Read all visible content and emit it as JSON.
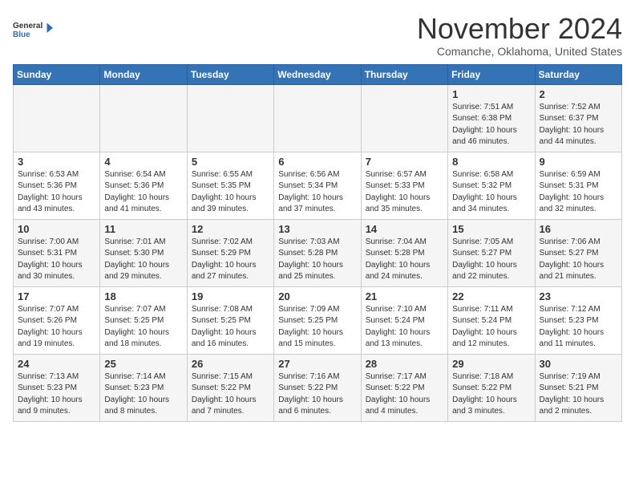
{
  "logo": {
    "general": "General",
    "blue": "Blue"
  },
  "title": "November 2024",
  "location": "Comanche, Oklahoma, United States",
  "weekdays": [
    "Sunday",
    "Monday",
    "Tuesday",
    "Wednesday",
    "Thursday",
    "Friday",
    "Saturday"
  ],
  "weeks": [
    [
      {
        "day": "",
        "info": ""
      },
      {
        "day": "",
        "info": ""
      },
      {
        "day": "",
        "info": ""
      },
      {
        "day": "",
        "info": ""
      },
      {
        "day": "",
        "info": ""
      },
      {
        "day": "1",
        "info": "Sunrise: 7:51 AM\nSunset: 6:38 PM\nDaylight: 10 hours\nand 46 minutes."
      },
      {
        "day": "2",
        "info": "Sunrise: 7:52 AM\nSunset: 6:37 PM\nDaylight: 10 hours\nand 44 minutes."
      }
    ],
    [
      {
        "day": "3",
        "info": "Sunrise: 6:53 AM\nSunset: 5:36 PM\nDaylight: 10 hours\nand 43 minutes."
      },
      {
        "day": "4",
        "info": "Sunrise: 6:54 AM\nSunset: 5:36 PM\nDaylight: 10 hours\nand 41 minutes."
      },
      {
        "day": "5",
        "info": "Sunrise: 6:55 AM\nSunset: 5:35 PM\nDaylight: 10 hours\nand 39 minutes."
      },
      {
        "day": "6",
        "info": "Sunrise: 6:56 AM\nSunset: 5:34 PM\nDaylight: 10 hours\nand 37 minutes."
      },
      {
        "day": "7",
        "info": "Sunrise: 6:57 AM\nSunset: 5:33 PM\nDaylight: 10 hours\nand 35 minutes."
      },
      {
        "day": "8",
        "info": "Sunrise: 6:58 AM\nSunset: 5:32 PM\nDaylight: 10 hours\nand 34 minutes."
      },
      {
        "day": "9",
        "info": "Sunrise: 6:59 AM\nSunset: 5:31 PM\nDaylight: 10 hours\nand 32 minutes."
      }
    ],
    [
      {
        "day": "10",
        "info": "Sunrise: 7:00 AM\nSunset: 5:31 PM\nDaylight: 10 hours\nand 30 minutes."
      },
      {
        "day": "11",
        "info": "Sunrise: 7:01 AM\nSunset: 5:30 PM\nDaylight: 10 hours\nand 29 minutes."
      },
      {
        "day": "12",
        "info": "Sunrise: 7:02 AM\nSunset: 5:29 PM\nDaylight: 10 hours\nand 27 minutes."
      },
      {
        "day": "13",
        "info": "Sunrise: 7:03 AM\nSunset: 5:28 PM\nDaylight: 10 hours\nand 25 minutes."
      },
      {
        "day": "14",
        "info": "Sunrise: 7:04 AM\nSunset: 5:28 PM\nDaylight: 10 hours\nand 24 minutes."
      },
      {
        "day": "15",
        "info": "Sunrise: 7:05 AM\nSunset: 5:27 PM\nDaylight: 10 hours\nand 22 minutes."
      },
      {
        "day": "16",
        "info": "Sunrise: 7:06 AM\nSunset: 5:27 PM\nDaylight: 10 hours\nand 21 minutes."
      }
    ],
    [
      {
        "day": "17",
        "info": "Sunrise: 7:07 AM\nSunset: 5:26 PM\nDaylight: 10 hours\nand 19 minutes."
      },
      {
        "day": "18",
        "info": "Sunrise: 7:07 AM\nSunset: 5:25 PM\nDaylight: 10 hours\nand 18 minutes."
      },
      {
        "day": "19",
        "info": "Sunrise: 7:08 AM\nSunset: 5:25 PM\nDaylight: 10 hours\nand 16 minutes."
      },
      {
        "day": "20",
        "info": "Sunrise: 7:09 AM\nSunset: 5:25 PM\nDaylight: 10 hours\nand 15 minutes."
      },
      {
        "day": "21",
        "info": "Sunrise: 7:10 AM\nSunset: 5:24 PM\nDaylight: 10 hours\nand 13 minutes."
      },
      {
        "day": "22",
        "info": "Sunrise: 7:11 AM\nSunset: 5:24 PM\nDaylight: 10 hours\nand 12 minutes."
      },
      {
        "day": "23",
        "info": "Sunrise: 7:12 AM\nSunset: 5:23 PM\nDaylight: 10 hours\nand 11 minutes."
      }
    ],
    [
      {
        "day": "24",
        "info": "Sunrise: 7:13 AM\nSunset: 5:23 PM\nDaylight: 10 hours\nand 9 minutes."
      },
      {
        "day": "25",
        "info": "Sunrise: 7:14 AM\nSunset: 5:23 PM\nDaylight: 10 hours\nand 8 minutes."
      },
      {
        "day": "26",
        "info": "Sunrise: 7:15 AM\nSunset: 5:22 PM\nDaylight: 10 hours\nand 7 minutes."
      },
      {
        "day": "27",
        "info": "Sunrise: 7:16 AM\nSunset: 5:22 PM\nDaylight: 10 hours\nand 6 minutes."
      },
      {
        "day": "28",
        "info": "Sunrise: 7:17 AM\nSunset: 5:22 PM\nDaylight: 10 hours\nand 4 minutes."
      },
      {
        "day": "29",
        "info": "Sunrise: 7:18 AM\nSunset: 5:22 PM\nDaylight: 10 hours\nand 3 minutes."
      },
      {
        "day": "30",
        "info": "Sunrise: 7:19 AM\nSunset: 5:21 PM\nDaylight: 10 hours\nand 2 minutes."
      }
    ]
  ]
}
